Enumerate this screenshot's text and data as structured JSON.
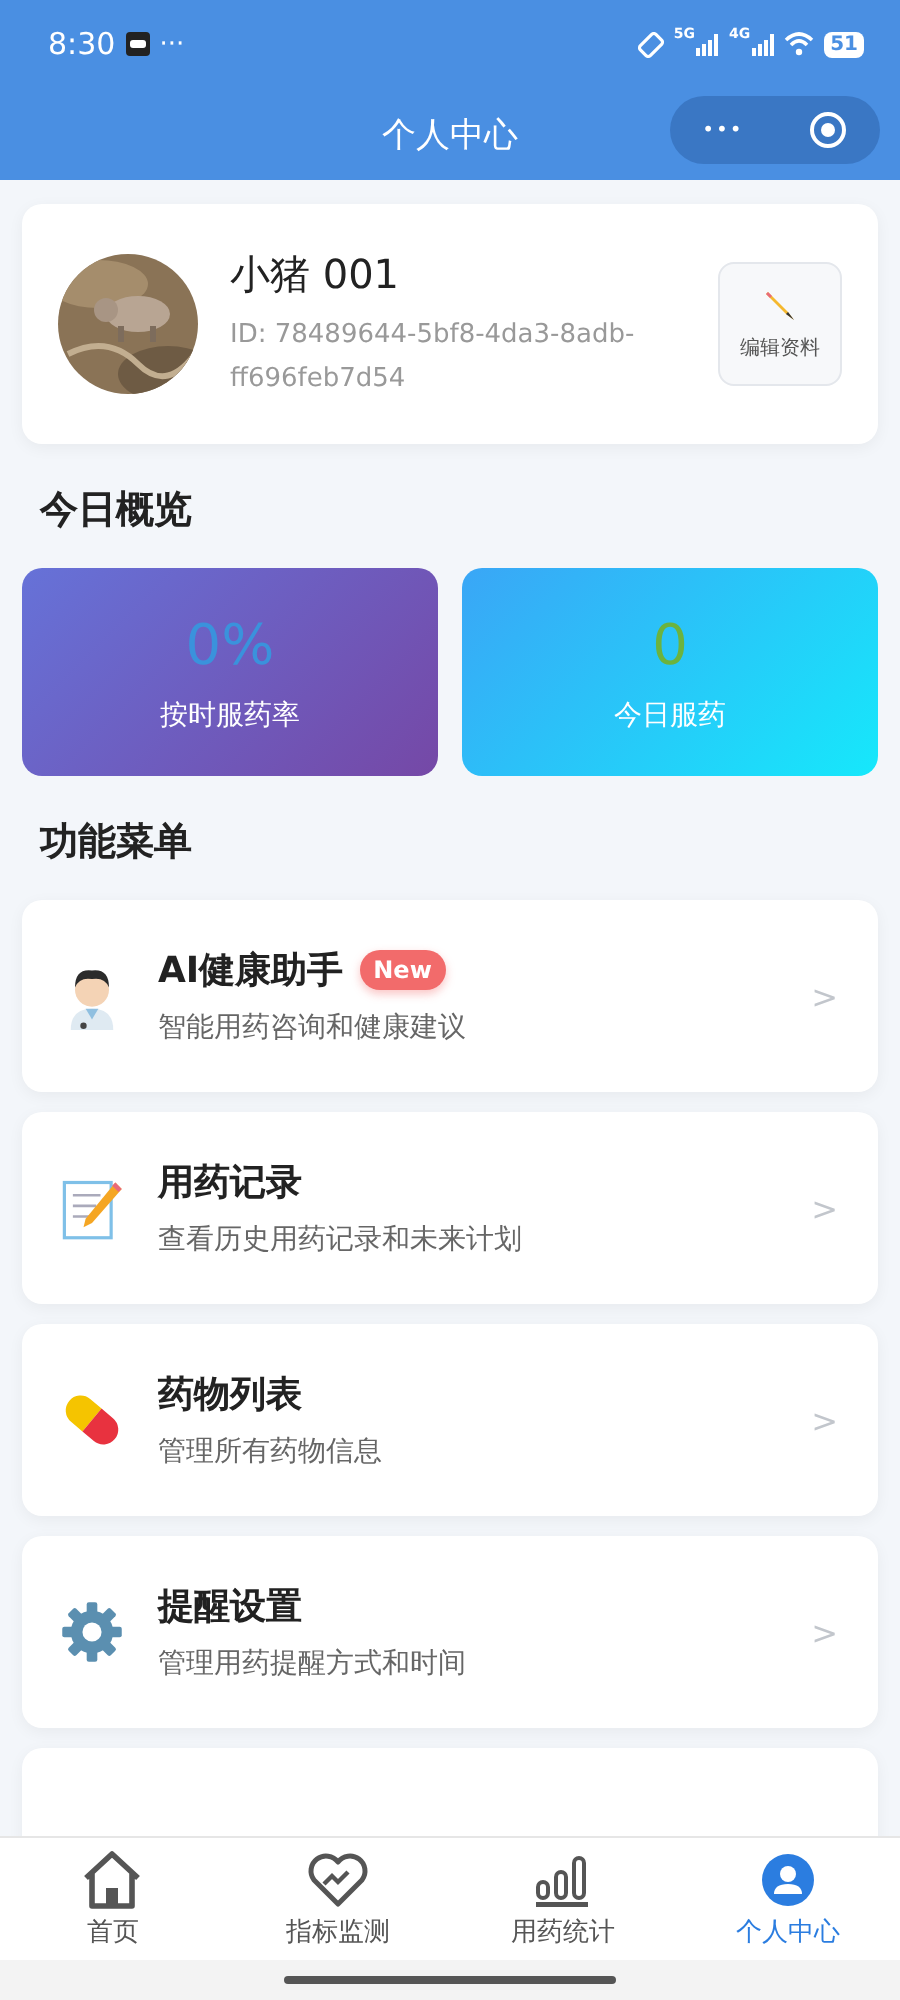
{
  "status_bar": {
    "time": "8:30",
    "more": "···",
    "networks": [
      "5G",
      "4G"
    ],
    "battery": "51"
  },
  "nav": {
    "title": "个人中心",
    "more": "•••"
  },
  "profile": {
    "name": "小猪 001",
    "id": "ID: 78489644-5bf8-4da3-8adb-ff696feb7d54",
    "edit_button": "编辑资料"
  },
  "overview": {
    "title": "今日概览",
    "stats": [
      {
        "value": "0%",
        "label": "按时服药率",
        "kind": "purple"
      },
      {
        "value": "0",
        "label": "今日服药",
        "kind": "cyan"
      }
    ]
  },
  "menu": {
    "title": "功能菜单",
    "items": [
      {
        "kind": "doctor",
        "title": "AI健康助手",
        "badge": "New",
        "subtitle": "智能用药咨询和健康建议",
        "chevron": ">"
      },
      {
        "kind": "memo",
        "title": "用药记录",
        "subtitle": "查看历史用药记录和未来计划",
        "chevron": ">"
      },
      {
        "kind": "pill",
        "title": "药物列表",
        "subtitle": "管理所有药物信息",
        "chevron": ">"
      },
      {
        "kind": "gear",
        "title": "提醒设置",
        "subtitle": "管理用药提醒方式和时间",
        "chevron": ">"
      }
    ]
  },
  "tab_bar": [
    {
      "label": "首页",
      "kind": "home",
      "selected": false
    },
    {
      "label": "指标监测",
      "kind": "heart",
      "selected": false
    },
    {
      "label": "用药统计",
      "kind": "stats",
      "selected": false
    },
    {
      "label": "个人中心",
      "kind": "person",
      "selected": true
    }
  ]
}
